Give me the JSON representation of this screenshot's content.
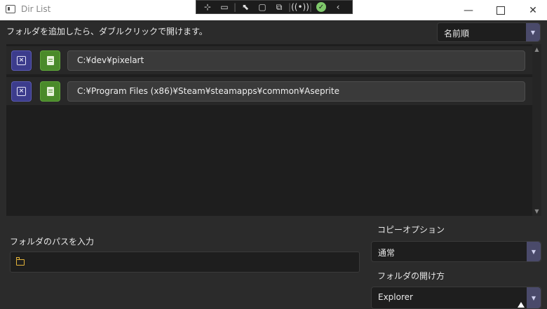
{
  "window": {
    "title": "Dir List",
    "minimize_glyph": "—",
    "close_glyph": "✕"
  },
  "debug_toolbar": {
    "icons": [
      "select-element-icon",
      "video-icon",
      "pointer-icon",
      "frame-icon",
      "layout-icon",
      "hot-reload-icon",
      "check-icon",
      "collapse-chevron-icon"
    ],
    "glyphs": [
      "⊹",
      "▭",
      "⬉",
      "▢",
      "⧉",
      "((•))",
      "✓",
      "‹"
    ]
  },
  "header": {
    "hint": "フォルダを追加したら、ダブルクリックで開けます。",
    "sort": {
      "selected": "名前順",
      "arrow": "▼"
    }
  },
  "list": {
    "items": [
      {
        "path": "C:¥dev¥pixelart"
      },
      {
        "path": "C:¥Program Files (x86)¥Steam¥steamapps¥common¥Aseprite"
      }
    ],
    "remove_glyph": "×",
    "scroll_up": "▲",
    "scroll_down": "▼"
  },
  "path_input": {
    "label": "フォルダのパスを入力",
    "value": ""
  },
  "copy_option": {
    "label": "コピーオプション",
    "selected": "通常",
    "arrow": "▼"
  },
  "open_method": {
    "label": "フォルダの開け方",
    "selected": "Explorer",
    "arrow": "▼"
  },
  "colors": {
    "background": "#2b2b2b",
    "remove_button": "#3c3c8c",
    "open_button": "#4a8a2a",
    "folder_icon": "#e4b43a"
  }
}
